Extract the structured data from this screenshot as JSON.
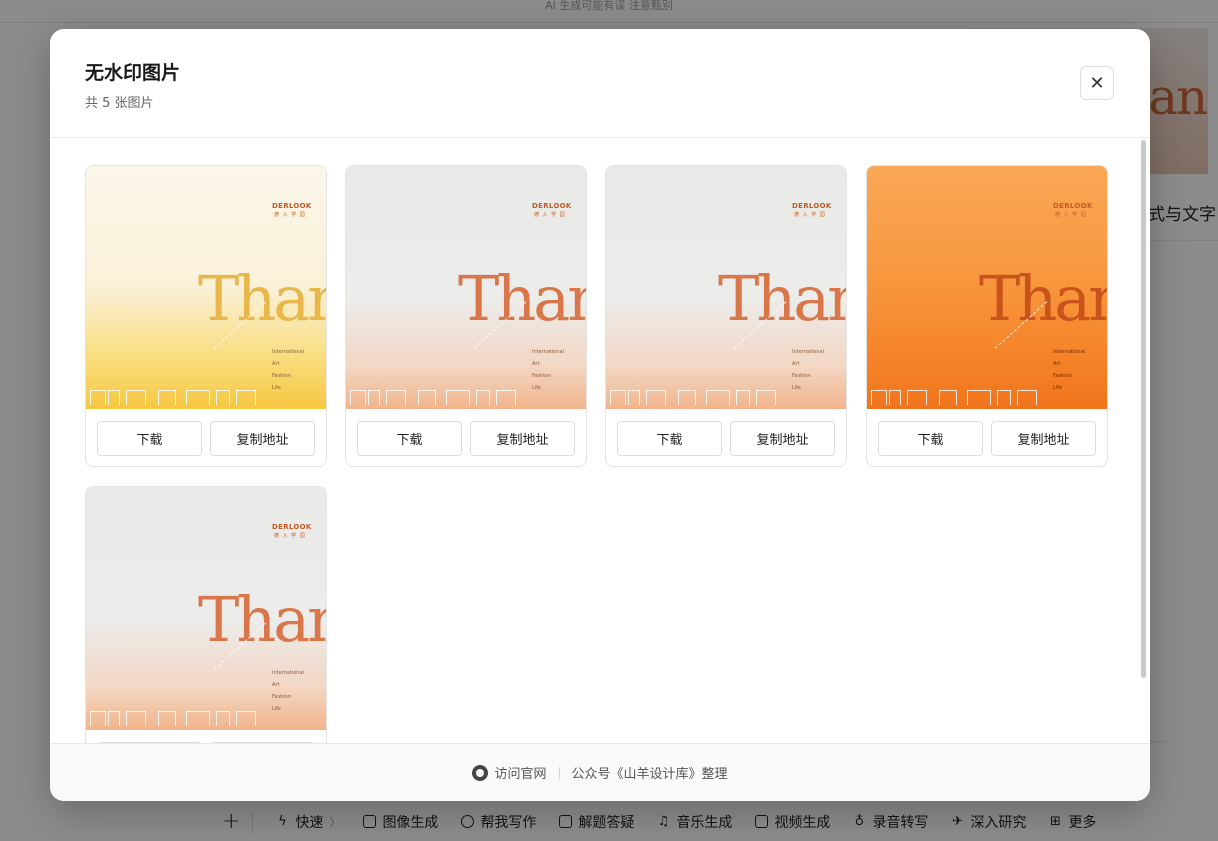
{
  "background": {
    "top_text": "AI 生成可能有误 注意甄别",
    "card_title": "式与文字",
    "card_word": "han",
    "toolbar": [
      {
        "icon": "bolt-icon",
        "label": "快速",
        "suffix": "〉"
      },
      {
        "icon": "image-icon",
        "label": "图像生成"
      },
      {
        "icon": "pen-icon",
        "label": "帮我写作"
      },
      {
        "icon": "quiz-icon",
        "label": "解题答疑"
      },
      {
        "icon": "music-icon",
        "label": "音乐生成"
      },
      {
        "icon": "video-icon",
        "label": "视频生成"
      },
      {
        "icon": "mic-icon",
        "label": "录音转写"
      },
      {
        "icon": "telescope-icon",
        "label": "深入研究"
      },
      {
        "icon": "grid-icon",
        "label": "更多"
      }
    ],
    "add_glyph": "+"
  },
  "modal": {
    "title": "无水印图片",
    "subtitle": "共 5 张图片",
    "close_glyph": "✕",
    "images": [
      {
        "theme": "yellow",
        "brand": "DERLOOK",
        "brand_sub": "德 入 学 园",
        "word": "Than",
        "lines": [
          "International",
          "Art",
          "Fashion",
          "Life"
        ]
      },
      {
        "theme": "grey",
        "brand": "DERLOOK",
        "brand_sub": "德 入 学 园",
        "word": "Than",
        "lines": [
          "International",
          "Art",
          "Fashion",
          "Life"
        ]
      },
      {
        "theme": "grey",
        "brand": "DERLOOK",
        "brand_sub": "德 入 学 园",
        "word": "Than",
        "lines": [
          "International",
          "Art",
          "Fashion",
          "Life"
        ]
      },
      {
        "theme": "orange",
        "brand": "DERLOOK",
        "brand_sub": "德 入 学 园",
        "word": "Than",
        "lines": [
          "International",
          "Art",
          "Fashion",
          "Life"
        ]
      },
      {
        "theme": "grey",
        "brand": "DERLOOK",
        "brand_sub": "德 入 学 园",
        "word": "Than",
        "lines": [
          "International",
          "Art",
          "Fashion",
          "Life"
        ]
      }
    ],
    "download_label": "下载",
    "copy_label": "复制地址",
    "footer": {
      "site_label": "访问官网",
      "credit": "公众号《山羊设计库》整理"
    }
  }
}
